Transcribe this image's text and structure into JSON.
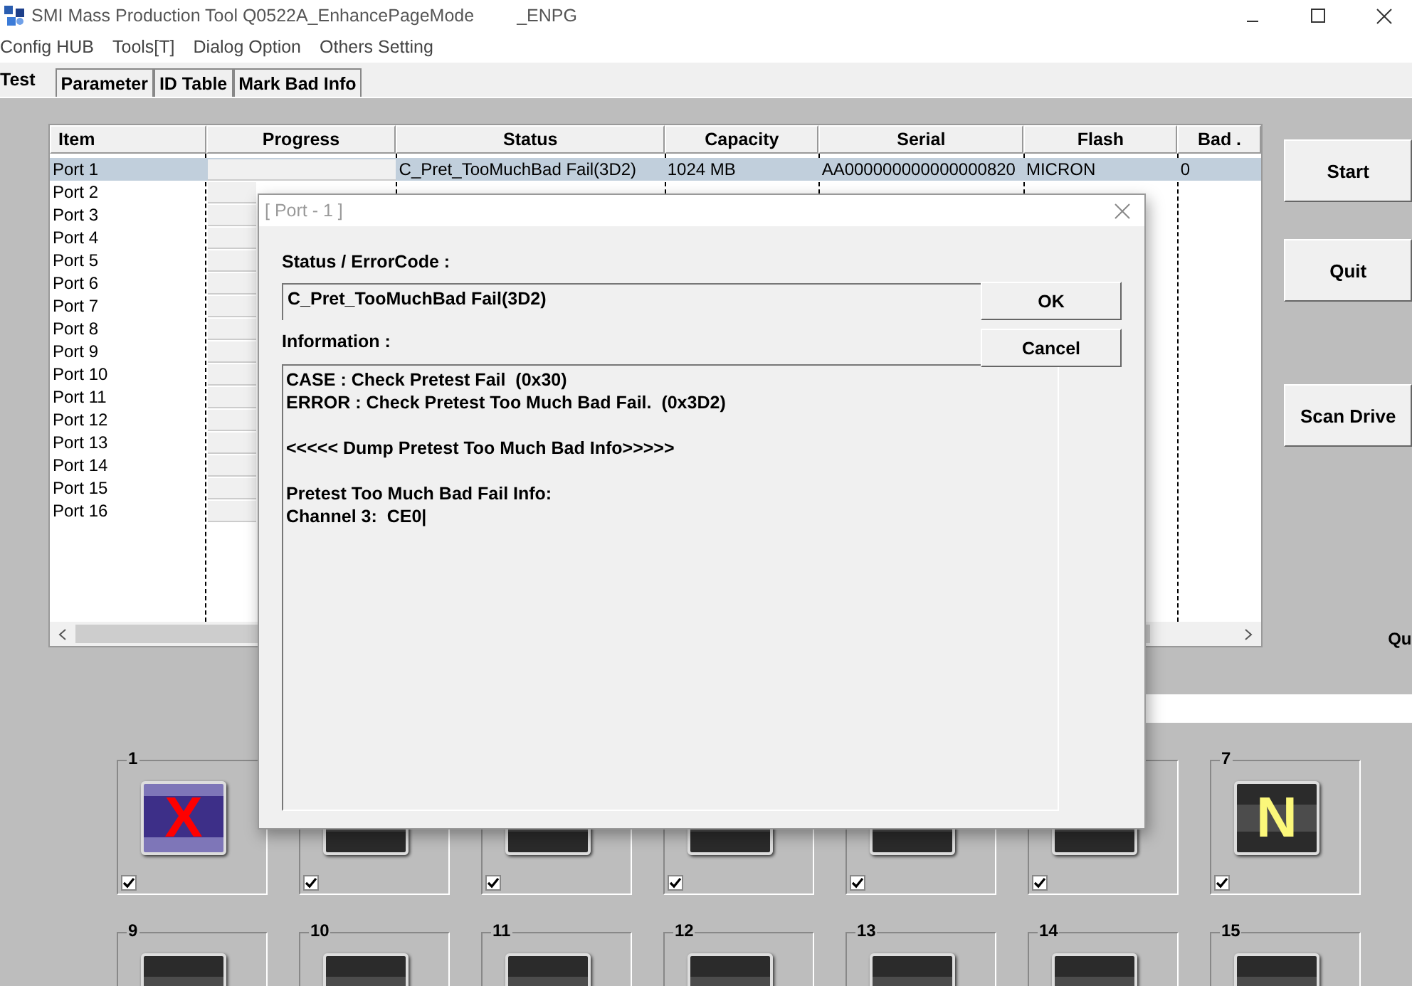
{
  "window": {
    "title": "SMI Mass Production Tool Q0522A_EnhancePageMode",
    "suffix": "_ENPG"
  },
  "menu": [
    "Config HUB",
    "Tools[T]",
    "Dialog Option",
    "Others Setting"
  ],
  "tabs": [
    {
      "label": "Test",
      "selected": true
    },
    {
      "label": "Parameter",
      "selected": false
    },
    {
      "label": "ID Table",
      "selected": false
    },
    {
      "label": "Mark Bad Info",
      "selected": false
    }
  ],
  "table": {
    "columns": [
      "Item",
      "Progress",
      "Status",
      "Capacity",
      "Serial",
      "Flash",
      "Bad ."
    ],
    "rows": [
      {
        "item": "Port 1",
        "selected": true,
        "status": "C_Pret_TooMuchBad Fail(3D2)",
        "capacity": "1024 MB",
        "serial": "AA000000000000000820",
        "flash": "MICRON",
        "bad": "0"
      },
      {
        "item": "Port 2",
        "selected": false
      },
      {
        "item": "Port 3",
        "selected": false
      },
      {
        "item": "Port 4",
        "selected": false
      },
      {
        "item": "Port 5",
        "selected": false
      },
      {
        "item": "Port 6",
        "selected": false
      },
      {
        "item": "Port 7",
        "selected": false
      },
      {
        "item": "Port 8",
        "selected": false
      },
      {
        "item": "Port 9",
        "selected": false
      },
      {
        "item": "Port 10",
        "selected": false
      },
      {
        "item": "Port 11",
        "selected": false
      },
      {
        "item": "Port 12",
        "selected": false
      },
      {
        "item": "Port 13",
        "selected": false
      },
      {
        "item": "Port 14",
        "selected": false
      },
      {
        "item": "Port 15",
        "selected": false
      },
      {
        "item": "Port 16",
        "selected": false
      }
    ]
  },
  "buttons": [
    "Start",
    "Quit",
    "Scan Drive"
  ],
  "side_label": "Qu",
  "tiles": [
    [
      {
        "label": "1",
        "kind": "fail",
        "mark": "X",
        "checked": true
      },
      {
        "kind": "ready",
        "checked": true
      },
      {
        "kind": "ready",
        "checked": true
      },
      {
        "kind": "ready",
        "checked": true
      },
      {
        "kind": "ready",
        "checked": true
      },
      {
        "kind": "ready",
        "checked": true
      },
      {
        "label": "7",
        "kind": "ready",
        "mark": "N",
        "checked": true
      }
    ],
    [
      {
        "label": "9",
        "kind": "ready"
      },
      {
        "label": "10",
        "kind": "ready"
      },
      {
        "label": "11",
        "kind": "ready"
      },
      {
        "label": "12",
        "kind": "ready"
      },
      {
        "label": "13",
        "kind": "ready"
      },
      {
        "label": "14",
        "kind": "ready"
      },
      {
        "label": "15",
        "kind": "ready"
      }
    ]
  ],
  "dialog": {
    "title": "[ Port - 1 ]",
    "status_label": "Status / ErrorCode :",
    "status_value": "C_Pret_TooMuchBad Fail(3D2)",
    "buttons": [
      "OK",
      "Cancel"
    ],
    "info_label": "Information :",
    "info_blocks": [
      [
        "CASE : Check Pretest Fail  (0x30)",
        "ERROR : Check Pretest Too Much Bad Fail.  (0x3D2)"
      ],
      [
        "<<<<< Dump Pretest Too Much Bad Info>>>>>"
      ],
      [
        "Pretest Too Much Bad Fail Info:",
        "Channel 3:  CE0|"
      ]
    ]
  }
}
